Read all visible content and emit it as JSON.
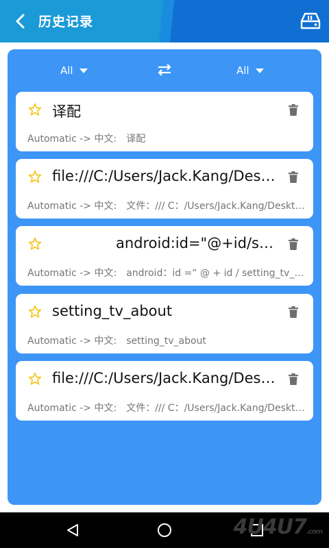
{
  "appbar": {
    "title": "历史记录",
    "back_icon": "back-arrow-icon",
    "right_icon": "sd-card-icon"
  },
  "language_bar": {
    "source_lang": "All",
    "target_lang": "All",
    "swap_icon": "swap-arrows-icon"
  },
  "history": [
    {
      "source": "译配",
      "direction": "Automatic -> 中文:",
      "translation": "译配"
    },
    {
      "source": "file:///C:/Users/Jack.Kang/Desktop/",
      "direction": "Automatic -> 中文:",
      "translation": "文件：/// C：/Users/Jack.Kang/Desktop/"
    },
    {
      "source": "android:id=\"@+id/setting_tv_about\"",
      "direction": "Automatic -> 中文:",
      "translation": "android：id =“ @ + id / setting_tv_about”"
    },
    {
      "source": "setting_tv_about",
      "direction": "Automatic -> 中文:",
      "translation": "setting_tv_about"
    },
    {
      "source": "file:///C:/Users/Jack.Kang/Desktop/",
      "direction": "Automatic -> 中文:",
      "translation": "文件：/// C：/Users/Jack.Kang/Desktop/"
    }
  ],
  "navbar": {
    "back": "nav-back-icon",
    "home": "nav-home-icon",
    "recents": "nav-recents-icon"
  },
  "watermark": {
    "text": "4U4U7",
    "suffix": ".com"
  },
  "colors": {
    "primary": "#0f6fd3",
    "panel": "#3d95f6",
    "star": "#f5c518",
    "card": "#ffffff"
  }
}
